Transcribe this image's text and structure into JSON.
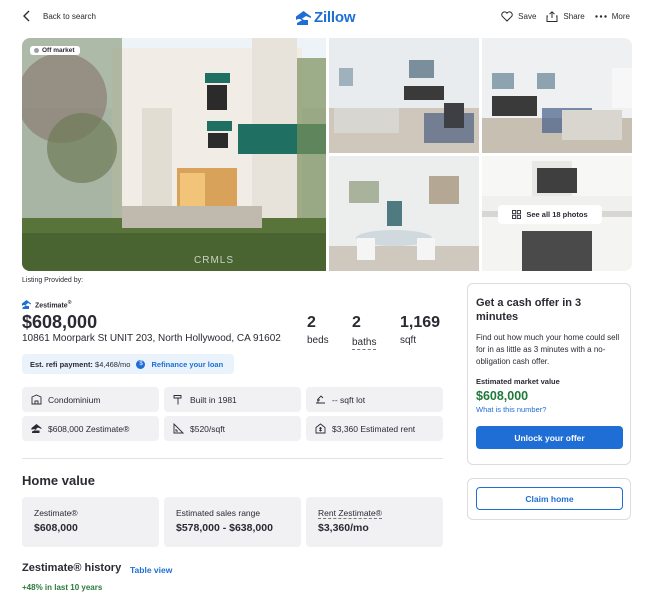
{
  "header": {
    "back_label": "Back to search",
    "logo_text": "Zillow",
    "actions": {
      "save": "Save",
      "share": "Share",
      "more": "More"
    }
  },
  "gallery": {
    "badge": "Off market",
    "see_all": "See all 18 photos",
    "watermark": "CRMLS"
  },
  "listing_provided": "Listing Provided by:",
  "summary": {
    "zestimate_label": "Zestimate",
    "zestimate_mark": "®",
    "price": "$608,000",
    "address": "10861 Moorpark St UNIT 203, North Hollywood, CA 91602",
    "beds_num": "2",
    "beds_label": "beds",
    "baths_num": "2",
    "baths_label": "baths",
    "sqft_num": "1,169",
    "sqft_label": "sqft"
  },
  "refi": {
    "label": "Est. refi payment:",
    "amount": "$4,468/mo",
    "icon_char": "$",
    "link": "Refinance your loan"
  },
  "facts": [
    {
      "icon": "building-icon",
      "text": "Condominium"
    },
    {
      "icon": "hammer-icon",
      "text": "Built in 1981"
    },
    {
      "icon": "lot-icon",
      "text": "-- sqft lot"
    },
    {
      "icon": "zestimate-icon",
      "text": "$608,000 Zestimate®"
    },
    {
      "icon": "ruler-icon",
      "text": "$520/sqft"
    },
    {
      "icon": "rent-icon",
      "text": "$3,360 Estimated rent"
    }
  ],
  "home_value": {
    "title": "Home value",
    "cards": [
      {
        "label": "Zestimate®",
        "value": "$608,000"
      },
      {
        "label": "Estimated sales range",
        "value": "$578,000 - $638,000"
      },
      {
        "label": "Rent Zestimate®",
        "value": "$3,360/mo"
      }
    ]
  },
  "history": {
    "title": "Zestimate® history",
    "link": "Table view",
    "change": "+48% in last 10 years"
  },
  "cash_offer": {
    "title": "Get a cash offer in 3 minutes",
    "description": "Find out how much your home could sell for in as little as 3 minutes with a no-obligation cash offer.",
    "est_label": "Estimated market value",
    "est_value": "$608,000",
    "what_link": "What is this number?",
    "button": "Unlock your offer"
  },
  "claim": {
    "button": "Claim home"
  },
  "colors": {
    "brand": "#1e6ed6",
    "positive": "#1f7a3a"
  }
}
